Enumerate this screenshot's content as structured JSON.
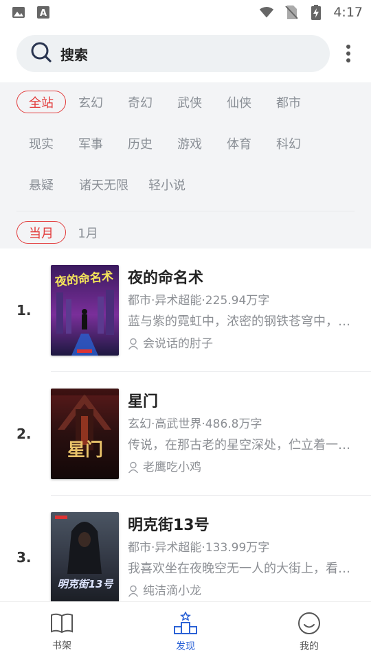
{
  "status_bar": {
    "time": "4:17",
    "icons": [
      "image-icon",
      "font-app-icon",
      "wifi-icon",
      "no-sim-icon",
      "battery-charging-icon"
    ]
  },
  "search": {
    "label": "搜索"
  },
  "categories": [
    "全站",
    "玄幻",
    "奇幻",
    "武侠",
    "仙侠",
    "都市",
    "现实",
    "军事",
    "历史",
    "游戏",
    "体育",
    "科幻",
    "悬疑",
    "诸天无限",
    "轻小说"
  ],
  "selected_category": "全站",
  "periods": [
    "当月",
    "1月"
  ],
  "selected_period": "当月",
  "books": [
    {
      "rank": "1.",
      "title": "夜的命名术",
      "meta": "都市·异术超能·225.94万字",
      "desc": "蓝与紫的霓虹中，浓密的钢铁苍穹中，数据洪流的前端...",
      "author": "会说话的肘子",
      "cover_text": "夜的命名术"
    },
    {
      "rank": "2.",
      "title": "星门",
      "meta": "玄幻·高武世界·486.8万字",
      "desc": "传说，在那古老的星空深处，伫立着一道血与火侵染的...",
      "author": "老鹰吃小鸡",
      "cover_text": "星门"
    },
    {
      "rank": "3.",
      "title": "明克街13号",
      "meta": "都市·异术超能·133.99万字",
      "desc": "我喜欢坐在夜晚空无一人的大街上，看着它的寂静与空...",
      "author": "纯洁滴小龙",
      "cover_text": "明克街13号"
    }
  ],
  "nav": [
    {
      "label": "书架",
      "icon": "bookshelf-icon"
    },
    {
      "label": "发现",
      "icon": "discover-podium-icon",
      "active": true
    },
    {
      "label": "我的",
      "icon": "profile-smile-icon"
    }
  ],
  "colors": {
    "accent": "#e23b3b",
    "nav_active": "#2b62d6",
    "filter_bg": "#f3f4f6"
  }
}
